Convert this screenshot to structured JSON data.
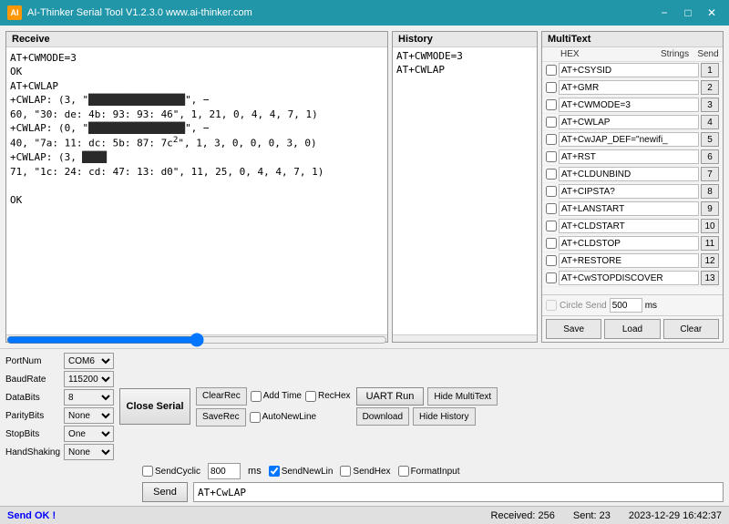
{
  "titleBar": {
    "title": "AI-Thinker Serial Tool V1.2.3.0   www.ai-thinker.com",
    "minimize": "−",
    "maximize": "□",
    "close": "✕"
  },
  "receive": {
    "header": "Receive",
    "content": "AT+CWMODE=3\r\nOK\r\nAT+CWLAP\r\n+CWLAP: (3, \"[REDACTED]\", −\r\n60, \"30: de: 4b: 93: 93: 46\", 1, 21, 0, 4, 4, 7, 1)\r\n+CWLAP: (0, \"[REDACTED]\", −\r\n40, \"7a: 11: dc: 5b: 87: 7c\", 1, 3, 0, 0, 0, 3, 0)\r\n+CWLAP: (3,\r\n71, \"1c: 24: cd: 47: 13: d0\", 11, 25, 0, 4, 4, 7, 1)\r\n\r\nOK"
  },
  "history": {
    "header": "History",
    "items": [
      "AT+CWMODE=3",
      "AT+CWLAP"
    ]
  },
  "multitext": {
    "header": "MultiText",
    "col_hex": "HEX",
    "col_strings": "Strings",
    "col_send": "Send",
    "rows": [
      {
        "checked": false,
        "value": "AT+CSYSID",
        "num": "1"
      },
      {
        "checked": false,
        "value": "AT+GMR",
        "num": "2"
      },
      {
        "checked": false,
        "value": "AT+CWMODE=3",
        "num": "3"
      },
      {
        "checked": false,
        "value": "AT+CWLAP",
        "num": "4"
      },
      {
        "checked": false,
        "value": "AT+CwJAP_DEF=\"newifi_",
        "num": "5"
      },
      {
        "checked": false,
        "value": "AT+RST",
        "num": "6"
      },
      {
        "checked": false,
        "value": "AT+CLDUNBIND",
        "num": "7"
      },
      {
        "checked": false,
        "value": "AT+CIPSTA?",
        "num": "8"
      },
      {
        "checked": false,
        "value": "AT+LANSTART",
        "num": "9"
      },
      {
        "checked": false,
        "value": "AT+CLDSTART",
        "num": "10"
      },
      {
        "checked": false,
        "value": "AT+CLDSTOP",
        "num": "11"
      },
      {
        "checked": false,
        "value": "AT+RESTORE",
        "num": "12"
      },
      {
        "checked": false,
        "value": "AT+CwSTOPDISCOVER",
        "num": "13"
      }
    ],
    "circleSend": "Circle Send",
    "circleValue": "500",
    "ms": "ms",
    "saveBtn": "Save",
    "loadBtn": "Load",
    "clearBtn": "Clear"
  },
  "controls": {
    "portNum": "PortNum",
    "portVal": "COM6",
    "baudRate": "BaudRate",
    "baudVal": "115200",
    "dataBits": "DataBits",
    "dataBitsVal": "8",
    "parityBits": "ParityBits",
    "parityVal": "None",
    "stopBits": "StopBits",
    "stopVal": "One",
    "handShaking": "HandShaking",
    "handVal": "None",
    "closeSerial": "Close Serial",
    "clearRec": "ClearRec",
    "saveRec": "SaveRec",
    "addTime": "Add Time",
    "recHex": "RecHex",
    "autoNewLine": "AutoNewLine",
    "uartRun": "UART Run",
    "download": "Download",
    "hideMultiText": "Hide MultiText",
    "hideHistory": "Hide History",
    "sendCyclic": "SendCyclic",
    "cyclicVal": "800",
    "cyclicMs": "ms",
    "sendNewLin": "SendNewLin",
    "sendHex": "SendHex",
    "formatInput": "FormatInput",
    "sendBtn": "Send",
    "sendInputVal": "AT+CwLAP"
  },
  "statusBar": {
    "ok": "Send OK !",
    "received": "Received: 256",
    "sent": "Sent: 23",
    "datetime": "2023-12-29 16:42:37"
  }
}
